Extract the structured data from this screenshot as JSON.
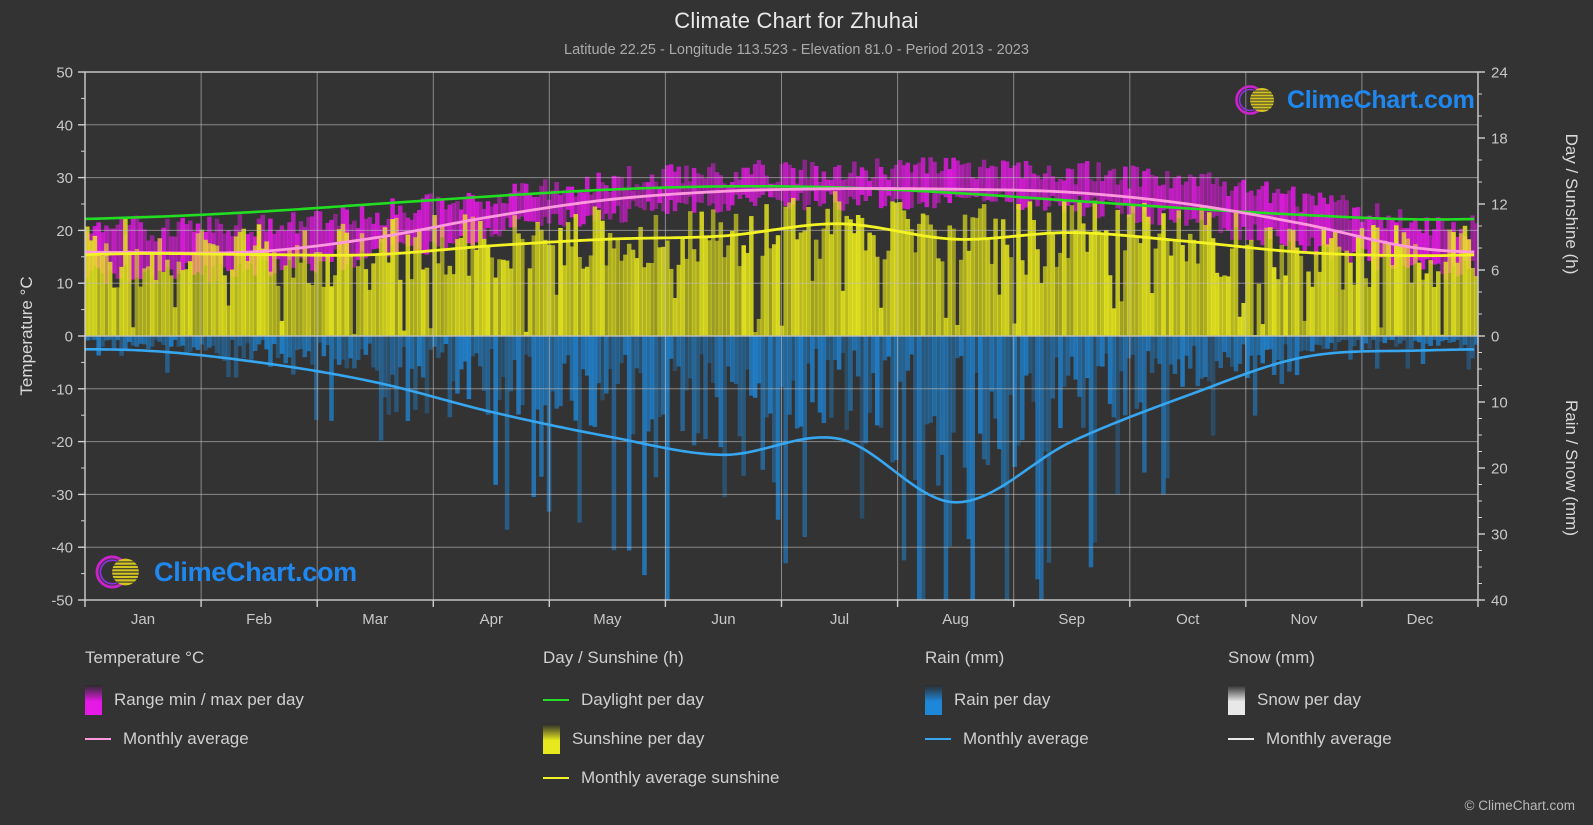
{
  "header": {
    "title": "Climate Chart for Zhuhai",
    "subtitle": "Latitude 22.25 - Longitude 113.523 - Elevation 81.0 - Period 2013 - 2023"
  },
  "branding": {
    "logo_text": "ClimeChart.com",
    "copyright": "© ClimeChart.com"
  },
  "colors": {
    "background": "#333333",
    "grid": "#9a9a9a",
    "text": "#cccccc",
    "temp_range": "#e619e6",
    "temp_avg": "#ff99dd",
    "daylight": "#22dd22",
    "sunshine": "#e8e81e",
    "sunshine_avg": "#f2f224",
    "rain": "#1f87d8",
    "rain_avg": "#36a6f0",
    "snow": "#e8e8e8"
  },
  "legend": {
    "columns": [
      {
        "heading": "Temperature °C",
        "entries": [
          {
            "label": "Range min / max per day",
            "marker": "box",
            "color": "#e619e6"
          },
          {
            "label": "Monthly average",
            "marker": "line",
            "color": "#ff99dd"
          }
        ]
      },
      {
        "heading": "Day / Sunshine (h)",
        "entries": [
          {
            "label": "Daylight per day",
            "marker": "line",
            "color": "#22dd22"
          },
          {
            "label": "Sunshine per day",
            "marker": "box",
            "color": "#e8e81e"
          },
          {
            "label": "Monthly average sunshine",
            "marker": "line",
            "color": "#f2f224"
          }
        ]
      },
      {
        "heading": "Rain (mm)",
        "entries": [
          {
            "label": "Rain per day",
            "marker": "box",
            "color": "#1f87d8"
          },
          {
            "label": "Monthly average",
            "marker": "line",
            "color": "#36a6f0"
          }
        ]
      },
      {
        "heading": "Snow (mm)",
        "entries": [
          {
            "label": "Snow per day",
            "marker": "box",
            "color": "#e8e8e8"
          },
          {
            "label": "Monthly average",
            "marker": "line",
            "color": "#e8e8e8"
          }
        ]
      }
    ]
  },
  "chart_data": {
    "type": "line",
    "title": "Climate Chart for Zhuhai",
    "subtitle": "Latitude 22.25 - Longitude 113.523 - Elevation 81.0 - Period 2013 - 2023",
    "xlabel": "",
    "categories": [
      "Jan",
      "Feb",
      "Mar",
      "Apr",
      "May",
      "Jun",
      "Jul",
      "Aug",
      "Sep",
      "Oct",
      "Nov",
      "Dec"
    ],
    "axes": {
      "left": {
        "label": "Temperature °C",
        "ticks": [
          50,
          40,
          30,
          20,
          10,
          0,
          -10,
          -20,
          -30,
          -40,
          -50
        ],
        "range": [
          -50,
          50
        ]
      },
      "right_top": {
        "label": "Day / Sunshine (h)",
        "ticks": [
          24,
          18,
          12,
          6,
          0
        ],
        "range": [
          0,
          24
        ],
        "maps_to_temp": [
          0,
          50
        ]
      },
      "right_bottom": {
        "label": "Rain / Snow (mm)",
        "ticks": [
          0,
          10,
          20,
          30,
          40
        ],
        "range": [
          0,
          40
        ],
        "maps_to_temp": [
          0,
          -50
        ],
        "inverted": true
      }
    },
    "grid": true,
    "legend_position": "below",
    "series": [
      {
        "name": "Monthly average",
        "unit": "°C",
        "axis": "left",
        "color": "#ff99dd",
        "values": [
          15.8,
          16.0,
          18.6,
          22.6,
          25.8,
          27.4,
          27.9,
          27.8,
          27.2,
          25.0,
          21.2,
          16.6
        ]
      },
      {
        "name": "Daylight per day",
        "unit": "h",
        "axis": "right_top",
        "color": "#22dd22",
        "values": [
          10.8,
          11.3,
          12.0,
          12.7,
          13.3,
          13.6,
          13.5,
          13.0,
          12.3,
          11.6,
          11.0,
          10.6
        ]
      },
      {
        "name": "Monthly average sunshine",
        "unit": "h",
        "axis": "right_top",
        "color": "#f2f224",
        "values": [
          7.5,
          7.4,
          7.4,
          8.2,
          8.8,
          9.1,
          10.2,
          8.8,
          9.4,
          8.6,
          7.6,
          7.3
        ]
      },
      {
        "name": "Rain monthly average",
        "unit": "mm",
        "axis": "right_bottom",
        "color": "#36a6f0",
        "values": [
          2.2,
          4.0,
          7.0,
          11.5,
          15.2,
          18.0,
          15.6,
          25.2,
          16.0,
          9.0,
          3.2,
          2.2
        ]
      },
      {
        "name": "Temperature range max per day",
        "unit": "°C",
        "axis": "left",
        "color": "#e619e6",
        "values": [
          20.0,
          20.5,
          22.8,
          26.4,
          29.0,
          30.4,
          31.0,
          31.0,
          30.6,
          28.6,
          25.2,
          21.0
        ]
      },
      {
        "name": "Temperature range min per day",
        "unit": "°C",
        "axis": "left",
        "color": "#e619e6",
        "values": [
          12.0,
          12.6,
          15.6,
          19.8,
          23.2,
          25.2,
          25.8,
          25.6,
          24.6,
          21.6,
          17.4,
          12.8
        ]
      }
    ]
  }
}
